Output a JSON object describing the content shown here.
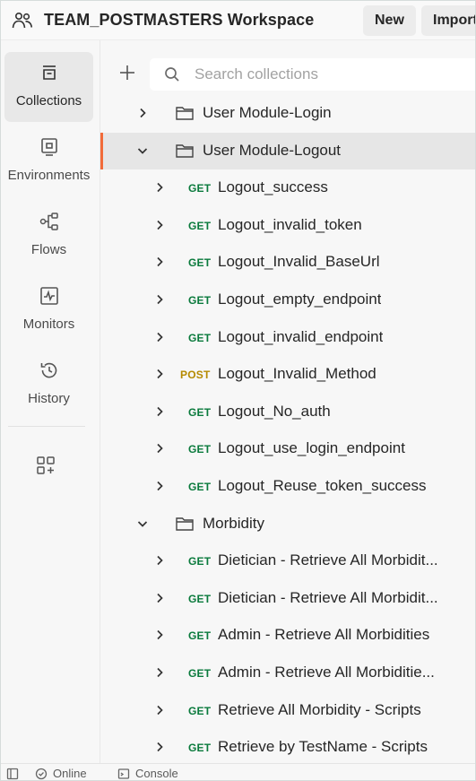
{
  "header": {
    "workspace_title": "TEAM_POSTMASTERS Workspace",
    "new_label": "New",
    "import_label": "Import"
  },
  "rail": {
    "items": [
      {
        "label": "Collections",
        "icon": "collections-icon",
        "active": true
      },
      {
        "label": "Environments",
        "icon": "environments-icon"
      },
      {
        "label": "Flows",
        "icon": "flows-icon"
      },
      {
        "label": "Monitors",
        "icon": "monitors-icon"
      },
      {
        "label": "History",
        "icon": "history-icon"
      }
    ],
    "more_icon": "add-apps-icon"
  },
  "toolbar": {
    "search_placeholder": "Search collections"
  },
  "colors": {
    "get": "#0a7a3c",
    "post": "#b58a00",
    "accent": "#f26b3a"
  },
  "tree": {
    "rows": [
      {
        "type": "folder",
        "label": "User Module-Login",
        "expanded": false
      },
      {
        "type": "folder",
        "label": "User Module-Logout",
        "expanded": true,
        "selected": true
      },
      {
        "type": "request",
        "method": "GET",
        "label": "Logout_success"
      },
      {
        "type": "request",
        "method": "GET",
        "label": "Logout_invalid_token"
      },
      {
        "type": "request",
        "method": "GET",
        "label": "Logout_Invalid_BaseUrl"
      },
      {
        "type": "request",
        "method": "GET",
        "label": "Logout_empty_endpoint"
      },
      {
        "type": "request",
        "method": "GET",
        "label": "Logout_invalid_endpoint"
      },
      {
        "type": "request",
        "method": "POST",
        "label": "Logout_Invalid_Method"
      },
      {
        "type": "request",
        "method": "GET",
        "label": "Logout_No_auth"
      },
      {
        "type": "request",
        "method": "GET",
        "label": "Logout_use_login_endpoint"
      },
      {
        "type": "request",
        "method": "GET",
        "label": "Logout_Reuse_token_success"
      },
      {
        "type": "folder",
        "label": "Morbidity",
        "expanded": true,
        "subfolder": true
      },
      {
        "type": "request",
        "method": "GET",
        "label": "Dietician - Retrieve All Morbidit..."
      },
      {
        "type": "request",
        "method": "GET",
        "label": "Dietician - Retrieve All Morbidit..."
      },
      {
        "type": "request",
        "method": "GET",
        "label": "Admin - Retrieve All Morbidities"
      },
      {
        "type": "request",
        "method": "GET",
        "label": "Admin - Retrieve All Morbiditie..."
      },
      {
        "type": "request",
        "method": "GET",
        "label": "Retrieve All Morbidity - Scripts"
      },
      {
        "type": "request",
        "method": "GET",
        "label": "Retrieve by TestName - Scripts"
      }
    ]
  },
  "footer": {
    "online_label": "Online",
    "console_label": "Console"
  }
}
